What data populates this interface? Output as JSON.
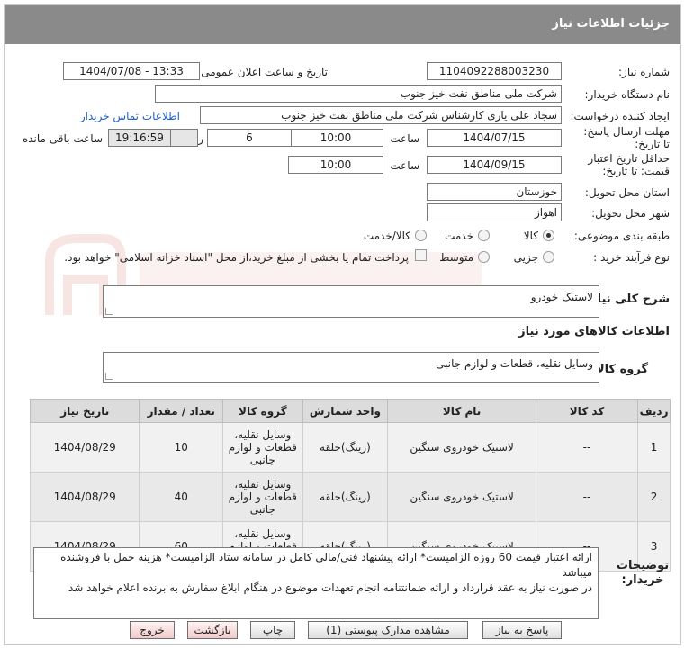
{
  "page": {
    "title": "جزئیات اطلاعات نیاز"
  },
  "form": {
    "need_number_label": "شماره نیاز:",
    "need_number": "1104092288003230",
    "announce_label": "تاریخ و ساعت اعلان عمومی:",
    "announce_value": "1404/07/08 - 13:33",
    "buyer_org_label": "نام دستگاه خریدار:",
    "buyer_org": "شرکت ملی مناطق نفت خیز جنوب",
    "requester_label": "ایجاد کننده درخواست:",
    "requester": "سجاد علی یاری کارشناس شرکت ملی مناطق نفت خیز جنوب",
    "contact_link": "اطلاعات تماس خریدار",
    "reply_deadline_label": "مهلت ارسال پاسخ: تا تاریخ:",
    "reply_date": "1404/07/15",
    "time_label": "ساعت",
    "reply_time": "10:00",
    "days_value": "6",
    "days_label": "روز و",
    "remaining_time": "19:16:59",
    "remaining_label": "ساعت باقی مانده",
    "validity_label": "حداقل تاریخ اعتبار قیمت: تا تاریخ:",
    "validity_date": "1404/09/15",
    "validity_time": "10:00",
    "province_label": "استان محل تحویل:",
    "province": "خوزستان",
    "city_label": "شهر محل تحویل:",
    "city": "اهواز",
    "category_label": "طبقه بندی موضوعی:",
    "category_options": [
      "کالا",
      "خدمت",
      "کالا/خدمت"
    ],
    "process_label": "نوع فرآیند خرید :",
    "process_options": [
      "جزیی",
      "متوسط"
    ],
    "treasury_note": "پرداخت تمام یا بخشی از مبلغ خرید،از محل \"اسناد خزانه اسلامی\" خواهد بود.",
    "description_label": "شرح کلی نیاز:",
    "description": "لاستیک خودرو",
    "goods_info_title": "اطلاعات کالاهای مورد نیاز",
    "goods_group_label": "گروه کالا:",
    "goods_group": "وسایل نقلیه، قطعات و لوازم جانبی"
  },
  "table": {
    "headers": [
      "ردیف",
      "کد کالا",
      "نام کالا",
      "واحد شمارش",
      "گروه کالا",
      "تعداد / مقدار",
      "تاریخ نیاز"
    ],
    "rows": [
      {
        "row": "1",
        "code": "--",
        "name": "لاستیک خودروی سنگین",
        "unit": "(رینگ)حلقه",
        "group": "وسایل نقلیه، قطعات و لوازم جانبی",
        "qty": "10",
        "date": "1404/08/29"
      },
      {
        "row": "2",
        "code": "--",
        "name": "لاستیک خودروی سنگین",
        "unit": "(رینگ)حلقه",
        "group": "وسایل نقلیه، قطعات و لوازم جانبی",
        "qty": "40",
        "date": "1404/08/29"
      },
      {
        "row": "3",
        "code": "--",
        "name": "لاستیک خودروی سنگین",
        "unit": "(رینگ)حلقه",
        "group": "وسایل نقلیه، قطعات و لوازم جانبی",
        "qty": "60",
        "date": "1404/08/29"
      }
    ]
  },
  "notes": {
    "label": "توضیحات خریدار:",
    "text": "ارائه اعتبار قیمت 60 روزه الزامیست* ارائه پیشنهاد فنی/مالی کامل در سامانه ستاد الزامیست* هزینه حمل با فروشنده میباشد\nدر صورت نیاز به عقد قرارداد و ارائه ضمانتنامه انجام تعهدات موضوع در هنگام ابلاغ سفارش به برنده اعلام خواهد شد"
  },
  "buttons": {
    "reply": "پاسخ به نیاز",
    "attachments": "مشاهده مدارک پیوستی (1)",
    "print": "چاپ",
    "back": "بازگشت",
    "exit": "خروج"
  },
  "colors": {
    "header_bg": "#8a8a8a",
    "link": "#1c5fc7",
    "watermark": "#c0302a"
  }
}
